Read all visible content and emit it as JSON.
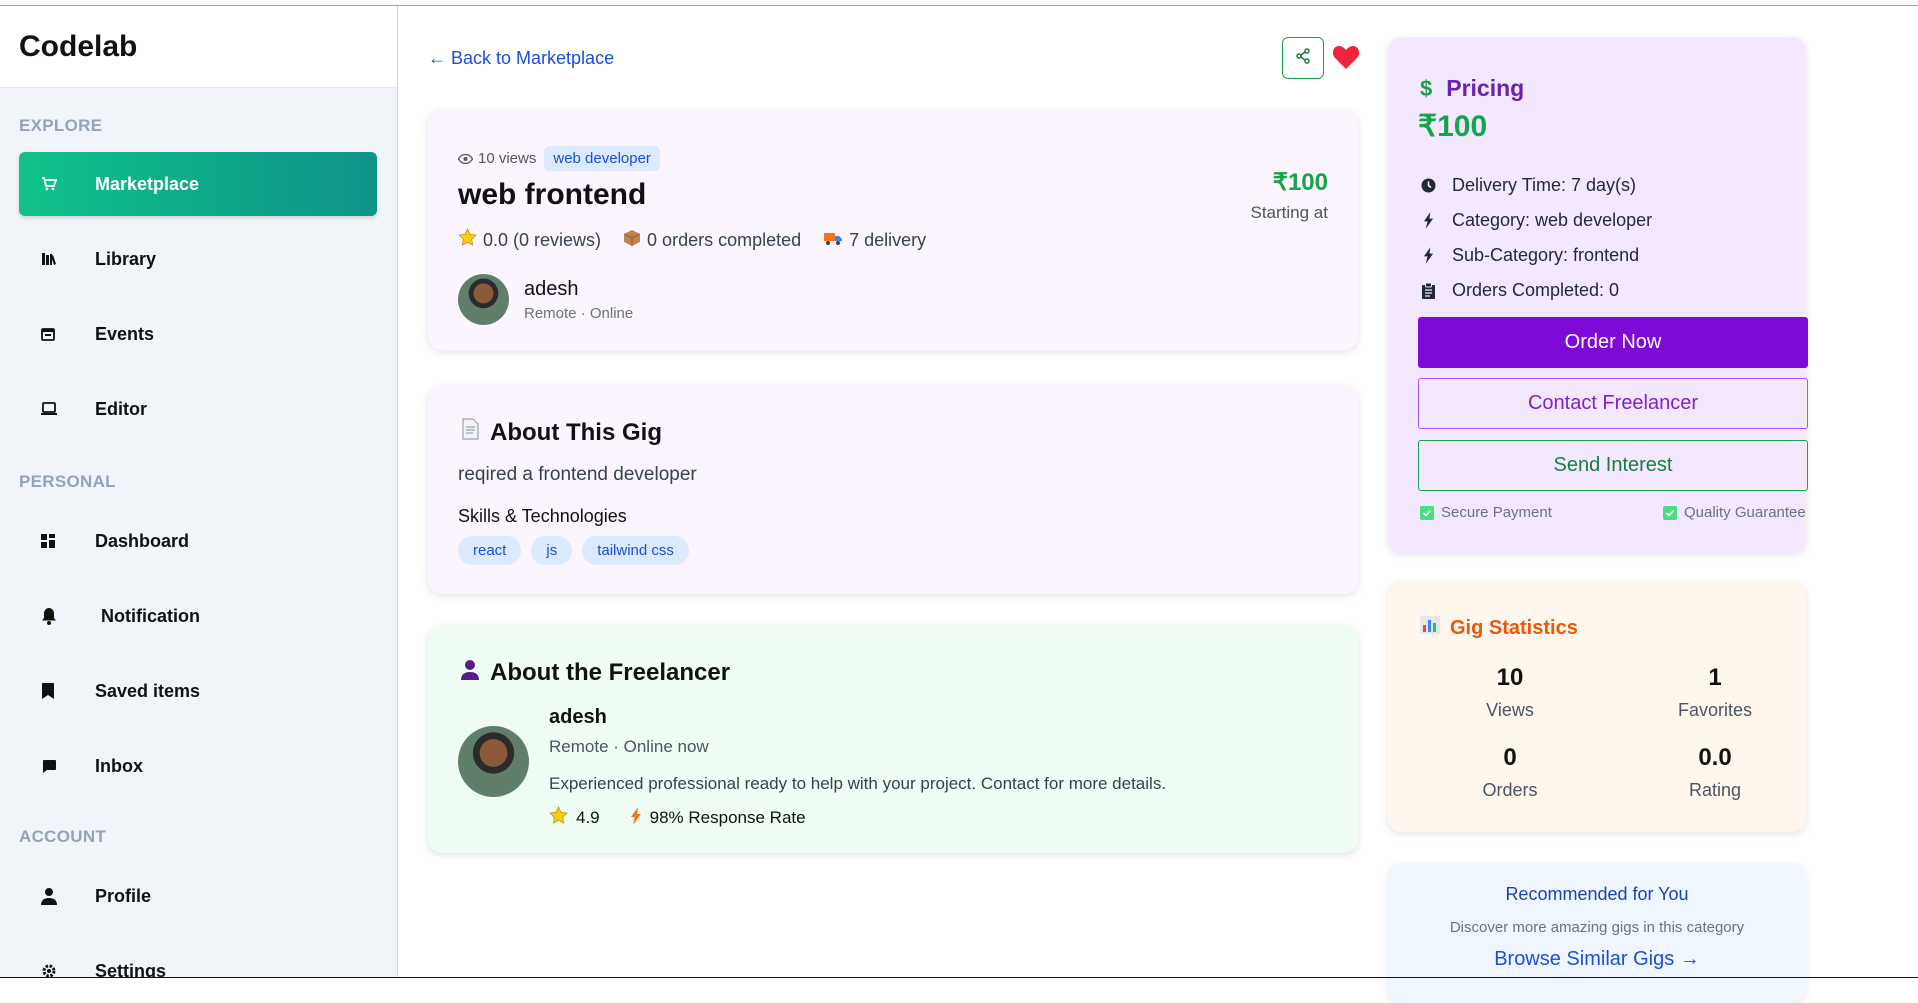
{
  "app": {
    "logo": "Codelab"
  },
  "sidebar": {
    "sections": [
      {
        "title": "EXPLORE"
      },
      {
        "title": "PERSONAL"
      },
      {
        "title": "ACCOUNT"
      }
    ],
    "items": [
      {
        "label": "Marketplace",
        "icon": "cart-icon",
        "active": true
      },
      {
        "label": "Library",
        "icon": "library-icon"
      },
      {
        "label": "Events",
        "icon": "calendar-icon"
      },
      {
        "label": "Editor",
        "icon": "laptop-icon"
      },
      {
        "label": "Dashboard",
        "icon": "dashboard-icon"
      },
      {
        "label": "Notification",
        "icon": "bell-icon"
      },
      {
        "label": "Saved items",
        "icon": "bookmark-icon"
      },
      {
        "label": "Inbox",
        "icon": "chat-icon"
      },
      {
        "label": "Profile",
        "icon": "user-icon"
      },
      {
        "label": "Settings",
        "icon": "gear-icon"
      }
    ]
  },
  "main": {
    "back_link": "← Back to Marketplace",
    "gig": {
      "views": "10 views",
      "tag": "web developer",
      "title": "web frontend",
      "rating": "0.0 (0 reviews)",
      "orders": "0 orders completed",
      "delivery": "7 delivery",
      "seller_name": "adesh",
      "seller_sub": "Remote · Online",
      "price": "₹100",
      "price_sub": "Starting at"
    },
    "about_gig": {
      "heading": "About This Gig",
      "description": "reqired a frontend developer",
      "skills_title": "Skills & Technologies",
      "skills": [
        "react",
        "js",
        "tailwind css"
      ]
    },
    "freelancer": {
      "heading": "About the Freelancer",
      "name": "adesh",
      "sub": "Remote · Online now",
      "description": "Experienced professional ready to help with your project. Contact for more details.",
      "rating": "4.9",
      "response_rate": "98% Response Rate"
    }
  },
  "pricing": {
    "heading": "Pricing",
    "price": "₹100",
    "rows": [
      {
        "label": "Delivery Time: 7 day(s)",
        "icon": "clock-icon"
      },
      {
        "label": "Category: web developer",
        "icon": "bolt-icon"
      },
      {
        "label": "Sub-Category: frontend",
        "icon": "bolt-icon"
      },
      {
        "label": "Orders Completed: 0",
        "icon": "clipboard-icon"
      }
    ],
    "order_button": "Order Now",
    "contact_button": "Contact Freelancer",
    "interest_button": "Send Interest",
    "secure": "Secure Payment",
    "quality": "Quality Guarantee"
  },
  "statistics": {
    "heading": "Gig Statistics",
    "views_value": "10",
    "views_label": "Views",
    "favorites_value": "1",
    "favorites_label": "Favorites",
    "orders_value": "0",
    "orders_label": "Orders",
    "rating_value": "0.0",
    "rating_label": "Rating"
  },
  "recommended": {
    "title": "Recommended for You",
    "subtitle": "Discover more amazing gigs in this category",
    "link": "Browse Similar Gigs →"
  },
  "colors": {
    "accent_green": "#16a34a",
    "brand_purple": "#7e0ad7",
    "sidebar_active": "#10c28a",
    "heart": "#ef233c"
  }
}
